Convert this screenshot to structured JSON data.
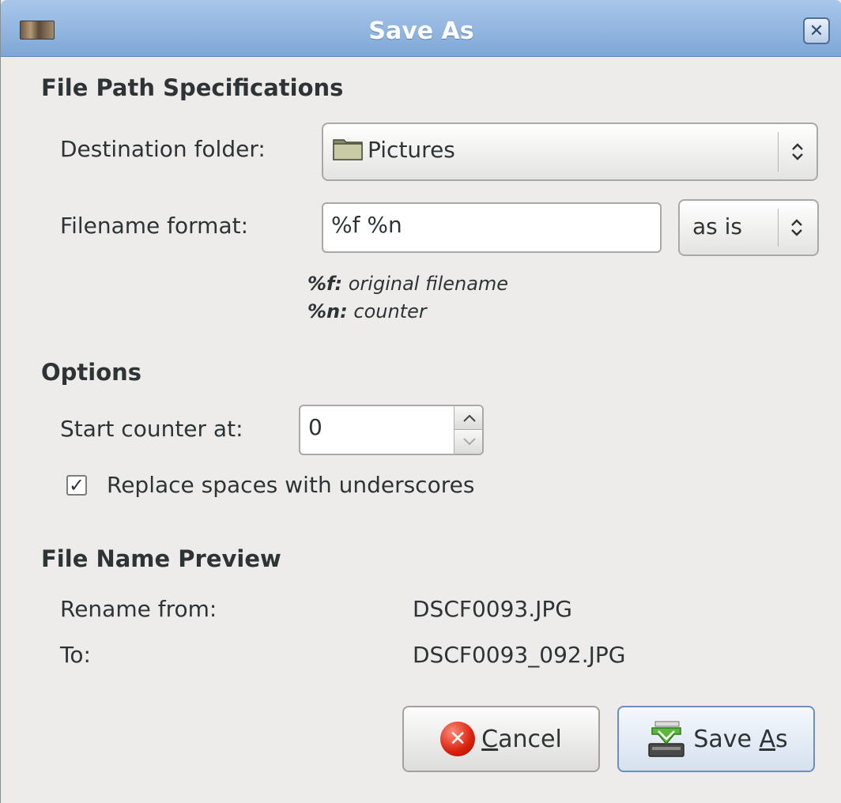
{
  "window": {
    "title": "Save As",
    "app_icon": "image-viewer-app-icon",
    "close_icon": "close-icon",
    "close_glyph": "✕"
  },
  "file_path": {
    "heading": "File Path Specifications",
    "destination_label": "Destination folder:",
    "destination_value": "Pictures",
    "filename_format_label": "Filename format:",
    "filename_format_value": "%f %n",
    "case_option": "as is",
    "hints": [
      {
        "key": "%f:",
        "text": "original filename"
      },
      {
        "key": "%n:",
        "text": "counter"
      }
    ]
  },
  "options": {
    "heading": "Options",
    "start_counter_label": "Start counter at:",
    "start_counter_value": "0",
    "replace_spaces_label": "Replace spaces with underscores",
    "replace_spaces_checked": true
  },
  "preview": {
    "heading": "File Name Preview",
    "from_label": "Rename from:",
    "from_value": "DSCF0093.JPG",
    "to_label": "To:",
    "to_value": "DSCF0093_092.JPG"
  },
  "buttons": {
    "cancel_mnemonic": "C",
    "cancel_rest": "ancel",
    "save_prefix": "Save ",
    "save_mnemonic": "A",
    "save_rest": "s"
  },
  "glyphs": {
    "combo_arrows": "⌃⌄",
    "spin_up": "▲",
    "spin_down": "▼",
    "checkmark": "✓",
    "cancel_x": "✕"
  },
  "colors": {
    "titlebar": "#8fb3de",
    "window_bg": "#edeceb",
    "cancel_red": "#d8200c",
    "save_green": "#5cb83a"
  }
}
